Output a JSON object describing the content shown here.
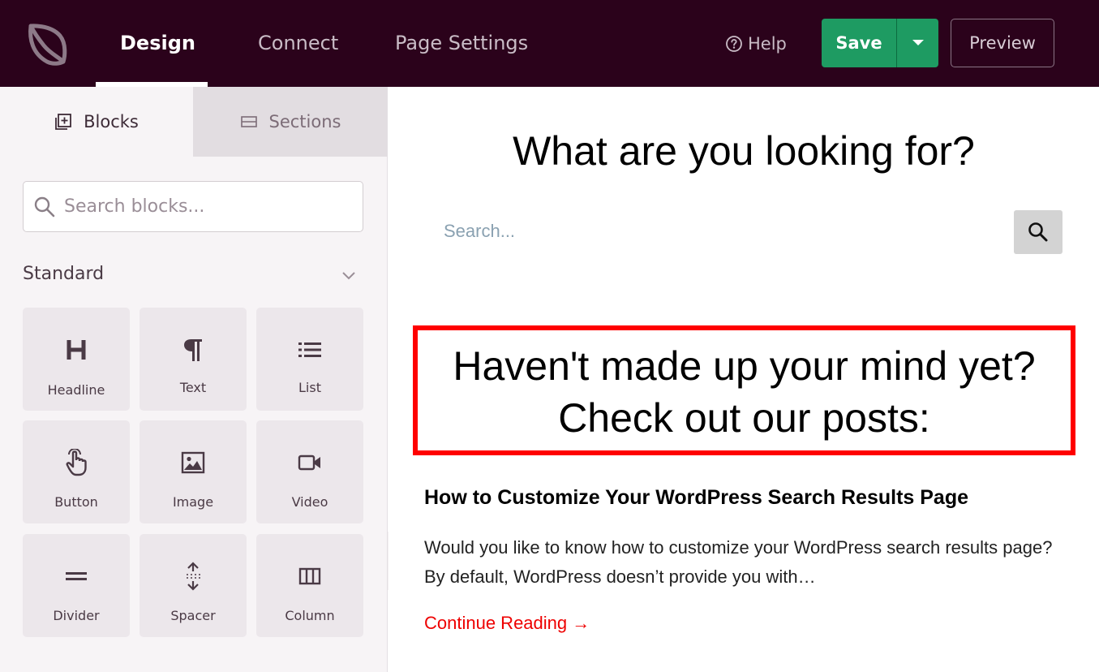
{
  "topbar": {
    "nav": [
      "Design",
      "Connect",
      "Page Settings"
    ],
    "help_label": "Help",
    "save_label": "Save",
    "preview_label": "Preview"
  },
  "sidebar": {
    "tabs": {
      "blocks": "Blocks",
      "sections": "Sections"
    },
    "search_placeholder": "Search blocks...",
    "standard_title": "Standard",
    "blocks": [
      {
        "label": "Headline",
        "icon": "headline-icon"
      },
      {
        "label": "Text",
        "icon": "paragraph-icon"
      },
      {
        "label": "List",
        "icon": "list-icon"
      },
      {
        "label": "Button",
        "icon": "hand-pointer-icon"
      },
      {
        "label": "Image",
        "icon": "image-icon"
      },
      {
        "label": "Video",
        "icon": "video-icon"
      },
      {
        "label": "Divider",
        "icon": "divider-icon"
      },
      {
        "label": "Spacer",
        "icon": "spacer-icon"
      },
      {
        "label": "Column",
        "icon": "column-icon"
      }
    ]
  },
  "canvas": {
    "heading": "What are you looking for?",
    "search_placeholder": "Search...",
    "highlight_line1": "Haven't made up your mind yet?",
    "highlight_line2": "Check out our posts:",
    "post_title": "How to Customize Your WordPress Search Results Page",
    "post_excerpt": "Would you like to know how to customize your WordPress search results page? By default, WordPress doesn’t provide you with…",
    "continue_label": "Continue Reading →"
  },
  "colors": {
    "topbar": "#2b021b",
    "save": "#1e9b62",
    "highlight": "#ff0000",
    "link": "#ee0000"
  }
}
